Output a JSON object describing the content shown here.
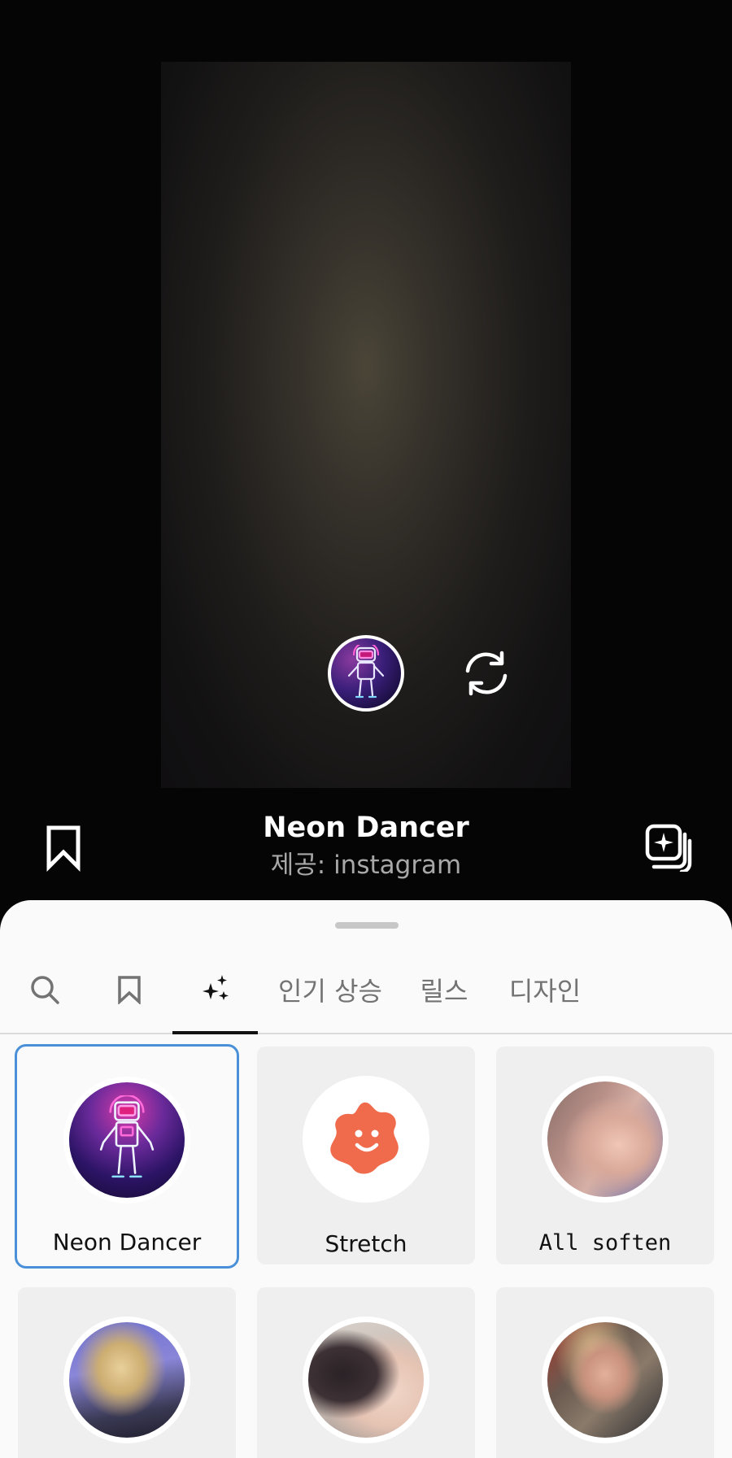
{
  "effect": {
    "title": "Neon Dancer",
    "creator": "제공: instagram"
  },
  "icons": {
    "effect_button": "neon-dancer-robot-icon",
    "flip": "flip-camera-icon",
    "save": "bookmark-icon",
    "try": "add-to-story-icon"
  },
  "tabs": [
    {
      "type": "icon",
      "icon": "search-icon"
    },
    {
      "type": "icon",
      "icon": "bookmark-icon"
    },
    {
      "type": "icon",
      "icon": "sparkles-icon",
      "selected": true
    },
    {
      "type": "text",
      "label": "인기 상승"
    },
    {
      "type": "text",
      "label": "릴스"
    },
    {
      "type": "text",
      "label": "디자인"
    }
  ],
  "effects_grid": [
    {
      "label": "Neon Dancer",
      "selected": true,
      "thumb": "neon-robot-thumbnail"
    },
    {
      "label": "Stretch",
      "thumb": "orange-blob-smiley-thumbnail"
    },
    {
      "label": "All soften",
      "thumb": "portrait-thumbnail"
    },
    {
      "label": "",
      "thumb": "portrait-thumbnail"
    },
    {
      "label": "",
      "thumb": "portrait-thumbnail"
    },
    {
      "label": "",
      "thumb": "portrait-thumbnail"
    }
  ],
  "colors": {
    "selected_border": "#4a90d9",
    "sheet_background": "#fafafa",
    "card_background": "#efefef"
  }
}
